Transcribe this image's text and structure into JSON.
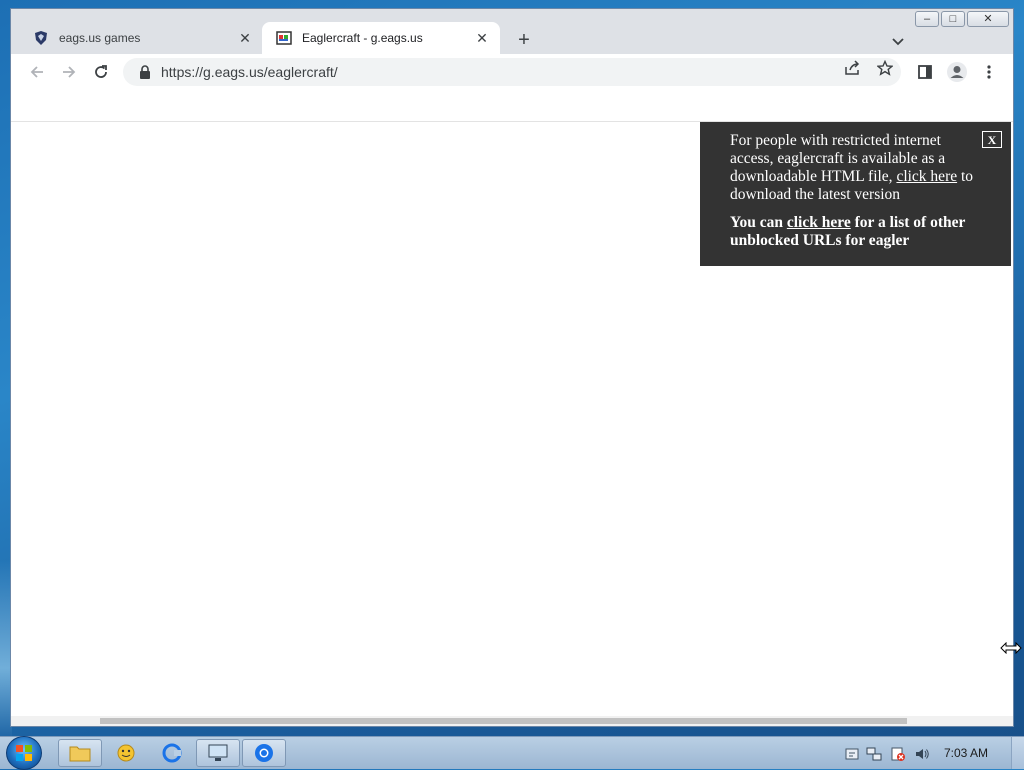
{
  "browser": {
    "tabs": [
      {
        "title": "eags.us games",
        "active": false,
        "favicon": "eagle-shield-icon"
      },
      {
        "title": "Eaglercraft - g.eags.us",
        "active": true,
        "favicon": "eaglercraft-icon"
      }
    ],
    "new_tab_label": "+",
    "address": "https://g.eags.us/eaglercraft/"
  },
  "window_controls": {
    "minimize": "–",
    "maximize": "□",
    "close": "✕"
  },
  "notice": {
    "close_label": "X",
    "p1_text_before": "For people with restricted internet access, eaglercraft is available as a downloadable HTML file, ",
    "p1_link": "click here",
    "p1_text_after": " to download the latest version",
    "p2_text_before": "You can ",
    "p2_link": "click here",
    "p2_text_after": " for a list of other unblocked URLs for eagler"
  },
  "taskbar": {
    "clock": "7:03 AM"
  }
}
